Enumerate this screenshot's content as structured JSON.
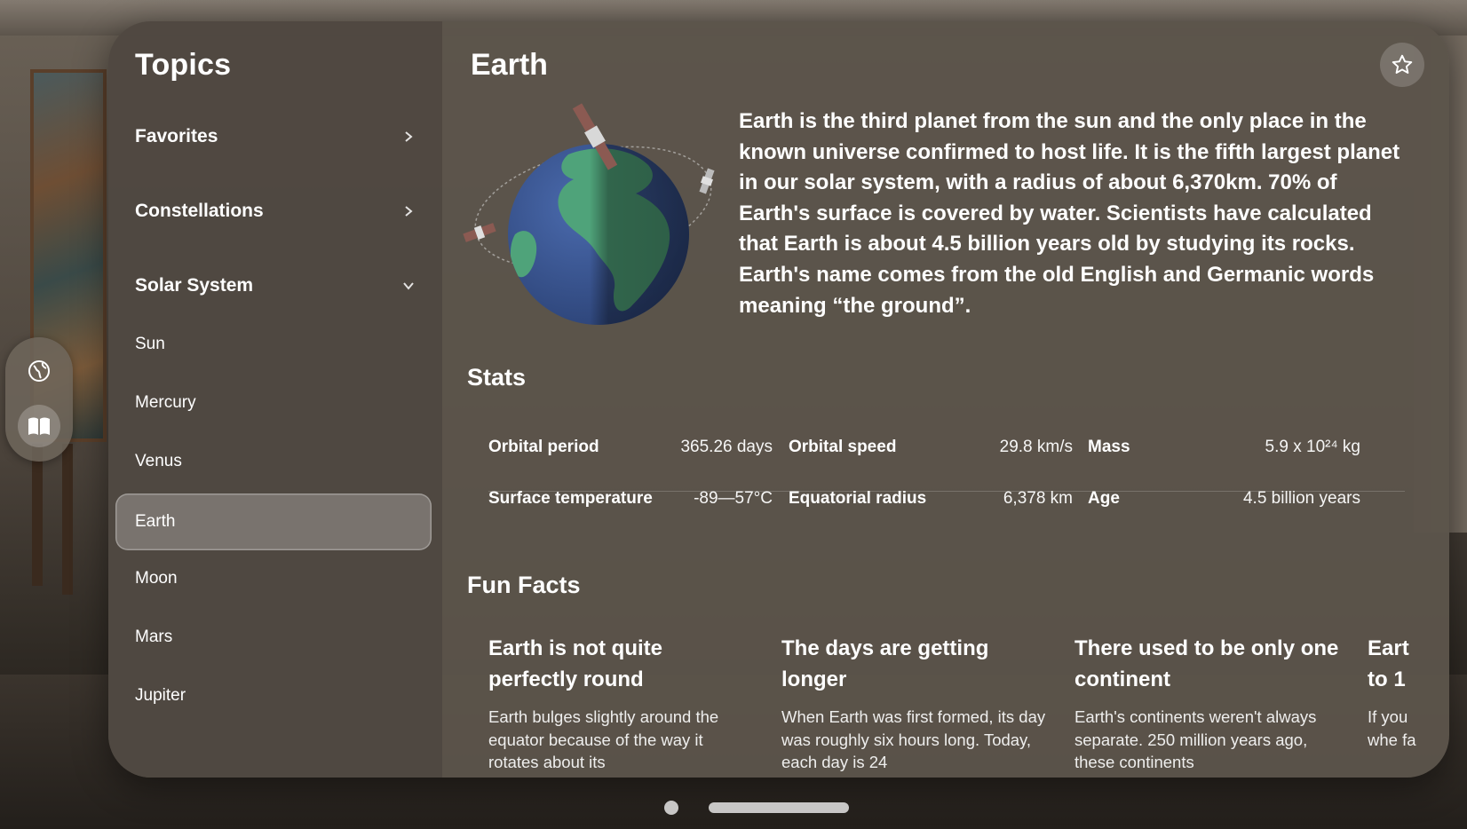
{
  "sidebar": {
    "title": "Topics",
    "sections": [
      {
        "label": "Favorites",
        "state": "collapsed"
      },
      {
        "label": "Constellations",
        "state": "collapsed"
      },
      {
        "label": "Solar System",
        "state": "expanded"
      }
    ],
    "planets": [
      "Sun",
      "Mercury",
      "Venus",
      "Earth",
      "Moon",
      "Mars",
      "Jupiter"
    ],
    "selected": "Earth"
  },
  "ornament": {
    "icons": [
      "globe-icon",
      "book-icon"
    ],
    "active": "book-icon"
  },
  "main": {
    "title": "Earth",
    "favorite_icon": "star-icon",
    "description": "Earth is the third planet from the sun and the only place in the known universe confirmed to host life. It is the fifth largest planet in our solar system, with a radius of about 6,370km. 70% of Earth's surface is covered by water. Scientists have calculated that Earth is about 4.5 billion years old by studying its rocks. Earth's name comes from the old English and Germanic words meaning “the ground”.",
    "stats_title": "Stats",
    "stats": [
      {
        "label": "Orbital period",
        "value": "365.26 days"
      },
      {
        "label": "Orbital speed",
        "value": "29.8 km/s"
      },
      {
        "label": "Mass",
        "value": "5.9 x 10²⁴ kg"
      },
      {
        "label": "Surface temperature",
        "value": "-89—57°C"
      },
      {
        "label": "Equatorial radius",
        "value": "6,378 km"
      },
      {
        "label": "Age",
        "value": "4.5 billion years"
      }
    ],
    "facts_title": "Fun Facts",
    "facts": [
      {
        "title": "Earth is not quite perfectly round",
        "body": "Earth bulges slightly around the equator because of the way it rotates about its"
      },
      {
        "title": "The days are getting longer",
        "body": "When Earth was first formed, its day was roughly six hours long. Today, each day is 24"
      },
      {
        "title": "There used to be only one continent",
        "body": "Earth's continents weren't always separate. 250 million years ago, these continents"
      },
      {
        "title": "Eart to 1",
        "body": "If you whe fa"
      }
    ]
  },
  "colors": {
    "window_bg": "#5c544b",
    "sidebar_bg": "#4e473f",
    "selection": "#8a8279",
    "ocean": "#3f5c9a",
    "land": "#4fa37a"
  }
}
